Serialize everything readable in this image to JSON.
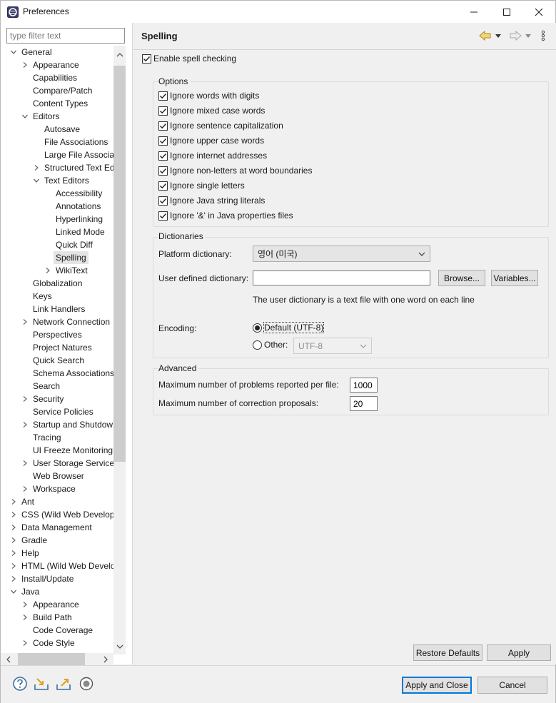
{
  "window": {
    "title": "Preferences"
  },
  "filter": {
    "placeholder": "type filter text"
  },
  "tree": {
    "items": [
      {
        "label": "General",
        "level": 0,
        "state": "expanded"
      },
      {
        "label": "Appearance",
        "level": 1,
        "state": "collapsed"
      },
      {
        "label": "Capabilities",
        "level": 1,
        "state": "leaf"
      },
      {
        "label": "Compare/Patch",
        "level": 1,
        "state": "leaf"
      },
      {
        "label": "Content Types",
        "level": 1,
        "state": "leaf"
      },
      {
        "label": "Editors",
        "level": 1,
        "state": "expanded"
      },
      {
        "label": "Autosave",
        "level": 2,
        "state": "leaf"
      },
      {
        "label": "File Associations",
        "level": 2,
        "state": "leaf"
      },
      {
        "label": "Large File Associati",
        "level": 2,
        "state": "leaf"
      },
      {
        "label": "Structured Text Ed",
        "level": 2,
        "state": "collapsed"
      },
      {
        "label": "Text Editors",
        "level": 2,
        "state": "expanded"
      },
      {
        "label": "Accessibility",
        "level": 3,
        "state": "leaf"
      },
      {
        "label": "Annotations",
        "level": 3,
        "state": "leaf"
      },
      {
        "label": "Hyperlinking",
        "level": 3,
        "state": "leaf"
      },
      {
        "label": "Linked Mode",
        "level": 3,
        "state": "leaf"
      },
      {
        "label": "Quick Diff",
        "level": 3,
        "state": "leaf"
      },
      {
        "label": "Spelling",
        "level": 3,
        "state": "leaf",
        "selected": true
      },
      {
        "label": "WikiText",
        "level": 3,
        "state": "collapsed"
      },
      {
        "label": "Globalization",
        "level": 1,
        "state": "leaf"
      },
      {
        "label": "Keys",
        "level": 1,
        "state": "leaf"
      },
      {
        "label": "Link Handlers",
        "level": 1,
        "state": "leaf"
      },
      {
        "label": "Network Connection",
        "level": 1,
        "state": "collapsed"
      },
      {
        "label": "Perspectives",
        "level": 1,
        "state": "leaf"
      },
      {
        "label": "Project Natures",
        "level": 1,
        "state": "leaf"
      },
      {
        "label": "Quick Search",
        "level": 1,
        "state": "leaf"
      },
      {
        "label": "Schema Associations",
        "level": 1,
        "state": "leaf"
      },
      {
        "label": "Search",
        "level": 1,
        "state": "leaf"
      },
      {
        "label": "Security",
        "level": 1,
        "state": "collapsed"
      },
      {
        "label": "Service Policies",
        "level": 1,
        "state": "leaf"
      },
      {
        "label": "Startup and Shutdow",
        "level": 1,
        "state": "collapsed"
      },
      {
        "label": "Tracing",
        "level": 1,
        "state": "leaf"
      },
      {
        "label": "UI Freeze Monitoring",
        "level": 1,
        "state": "leaf"
      },
      {
        "label": "User Storage Service",
        "level": 1,
        "state": "collapsed"
      },
      {
        "label": "Web Browser",
        "level": 1,
        "state": "leaf"
      },
      {
        "label": "Workspace",
        "level": 1,
        "state": "collapsed"
      },
      {
        "label": "Ant",
        "level": 0,
        "state": "collapsed"
      },
      {
        "label": "CSS (Wild Web Develop",
        "level": 0,
        "state": "collapsed"
      },
      {
        "label": "Data Management",
        "level": 0,
        "state": "collapsed"
      },
      {
        "label": "Gradle",
        "level": 0,
        "state": "collapsed"
      },
      {
        "label": "Help",
        "level": 0,
        "state": "collapsed"
      },
      {
        "label": "HTML (Wild Web Develo",
        "level": 0,
        "state": "collapsed"
      },
      {
        "label": "Install/Update",
        "level": 0,
        "state": "collapsed"
      },
      {
        "label": "Java",
        "level": 0,
        "state": "expanded"
      },
      {
        "label": "Appearance",
        "level": 1,
        "state": "collapsed"
      },
      {
        "label": "Build Path",
        "level": 1,
        "state": "collapsed"
      },
      {
        "label": "Code Coverage",
        "level": 1,
        "state": "leaf"
      },
      {
        "label": "Code Style",
        "level": 1,
        "state": "collapsed"
      }
    ]
  },
  "page": {
    "title": "Spelling",
    "enable_label": "Enable spell checking",
    "enable_checked": true
  },
  "options": {
    "title": "Options",
    "items": [
      {
        "label": "Ignore words with digits",
        "checked": true
      },
      {
        "label": "Ignore mixed case words",
        "checked": true
      },
      {
        "label": "Ignore sentence capitalization",
        "checked": true
      },
      {
        "label": "Ignore upper case words",
        "checked": true
      },
      {
        "label": "Ignore internet addresses",
        "checked": true
      },
      {
        "label": "Ignore non-letters at word boundaries",
        "checked": true
      },
      {
        "label": "Ignore single letters",
        "checked": true
      },
      {
        "label": "Ignore Java string literals",
        "checked": true
      },
      {
        "label": "Ignore '&' in Java properties files",
        "checked": true
      }
    ]
  },
  "dictionaries": {
    "title": "Dictionaries",
    "platform_label": "Platform dictionary:",
    "platform_value": "영어 (미국)",
    "user_label": "User defined dictionary:",
    "user_value": "",
    "browse_label": "Browse...",
    "variables_label": "Variables...",
    "hint": "The user dictionary is a text file with one word on each line",
    "encoding_label": "Encoding:",
    "default_label": "Default (UTF-8)",
    "other_label": "Other:",
    "other_value": "UTF-8"
  },
  "advanced": {
    "title": "Advanced",
    "max_problems_label": "Maximum number of problems reported per file:",
    "max_problems_value": "1000",
    "max_proposals_label": "Maximum number of correction proposals:",
    "max_proposals_value": "20"
  },
  "buttons": {
    "restore": "Restore Defaults",
    "apply": "Apply",
    "apply_close": "Apply and Close",
    "cancel": "Cancel"
  }
}
